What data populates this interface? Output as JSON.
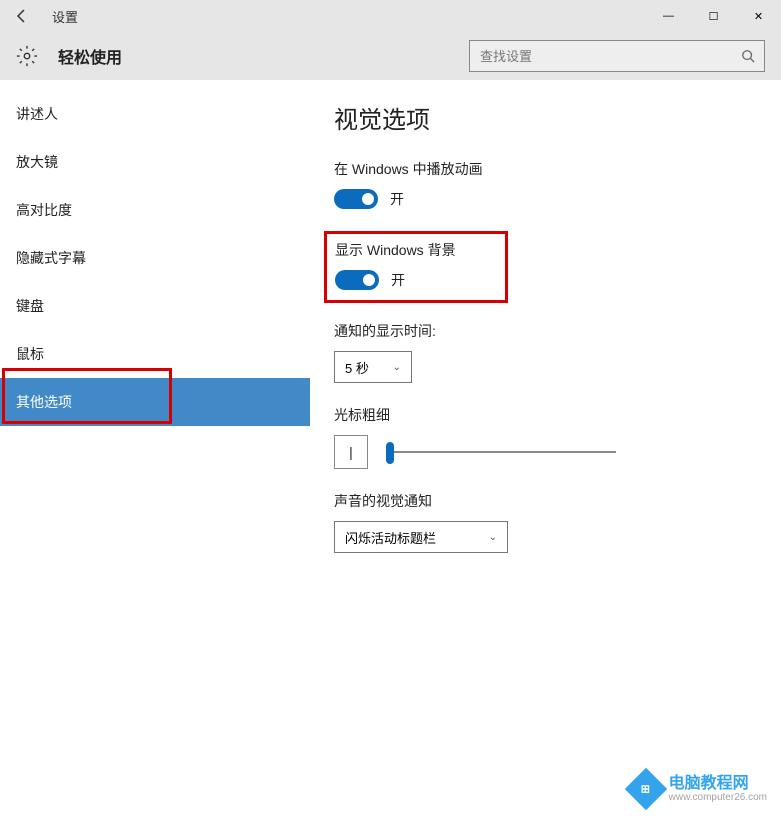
{
  "window": {
    "title": "设置",
    "minimize": "—",
    "maximize": "☐",
    "close": "✕"
  },
  "header": {
    "category": "轻松使用",
    "search_placeholder": "查找设置"
  },
  "sidebar": {
    "items": [
      {
        "label": "讲述人"
      },
      {
        "label": "放大镜"
      },
      {
        "label": "高对比度"
      },
      {
        "label": "隐藏式字幕"
      },
      {
        "label": "键盘"
      },
      {
        "label": "鼠标"
      },
      {
        "label": "其他选项",
        "selected": true
      }
    ]
  },
  "main": {
    "page_title": "视觉选项",
    "animations": {
      "label": "在 Windows 中播放动画",
      "state_text": "开"
    },
    "background": {
      "label": "显示 Windows 背景",
      "state_text": "开"
    },
    "notification_duration": {
      "label": "通知的显示时间:",
      "value": "5 秒"
    },
    "cursor": {
      "label": "光标粗细",
      "preview": "|"
    },
    "sound_visual": {
      "label": "声音的视觉通知",
      "value": "闪烁活动标题栏"
    }
  },
  "watermark": {
    "brand": "电脑教程网",
    "url": "www.computer26.com"
  }
}
